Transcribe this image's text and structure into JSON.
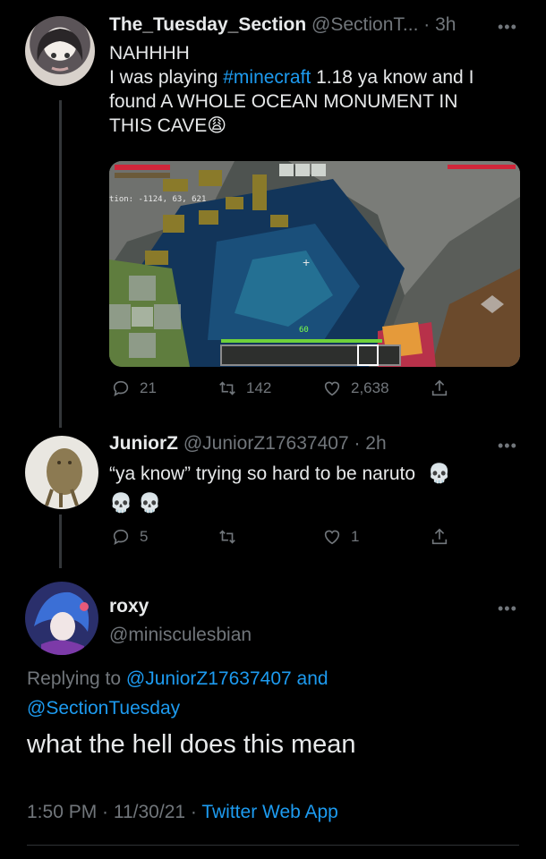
{
  "tweet1": {
    "name": "The_Tuesday_Section",
    "handle": "@SectionT...",
    "time": "· 3h",
    "line1": "NAHHHH",
    "line2_pre": "I was playing ",
    "hashtag": "#minecraft",
    "line2_post": " 1.18 ya know and I",
    "line3": "found A WHOLE OCEAN MONUMENT IN",
    "line4": "THIS CAVE",
    "emoji": "😩",
    "game_coords": "tion: -1124, 63, 621",
    "game_level": "60",
    "replies": "21",
    "retweets": "142",
    "likes": "2,638"
  },
  "tweet2": {
    "name": "JuniorZ",
    "handle": "@JuniorZ17637407",
    "time": "· 2h",
    "text": "“ya know” trying so hard to be naruto",
    "emoji_inline": "💀",
    "emoji_line2": "💀 💀",
    "replies": "5",
    "retweets": "",
    "likes": "1"
  },
  "tweet3": {
    "name": "roxy",
    "handle": "@minisculesbian",
    "replying_prefix": "Replying to ",
    "replying_user1": "@JuniorZ17637407",
    "replying_and": " and",
    "replying_user2": "@SectionTuesday",
    "text": "what the hell does this mean",
    "time": "1:50 PM · 11/30/21 · ",
    "source": "Twitter Web App"
  },
  "colors": {
    "link": "#1d9bf0",
    "muted": "#71767b",
    "text": "#e7e9ea"
  }
}
